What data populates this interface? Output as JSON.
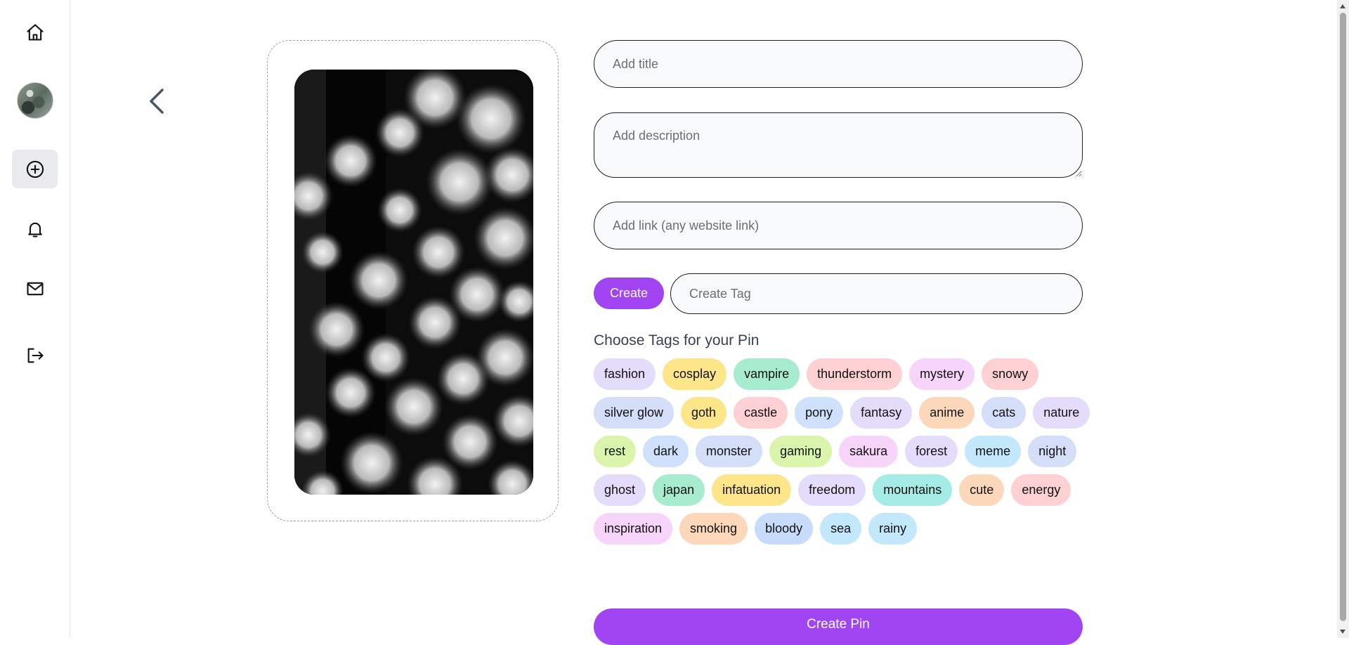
{
  "sidebar": {
    "items": [
      {
        "icon": "home-icon"
      },
      {
        "icon": "avatar"
      },
      {
        "icon": "plus-circle-icon",
        "active": true
      },
      {
        "icon": "bell-icon"
      },
      {
        "icon": "mail-icon"
      },
      {
        "icon": "logout-icon"
      }
    ]
  },
  "form": {
    "title_placeholder": "Add title",
    "description_placeholder": "Add description",
    "link_placeholder": "Add link (any website link)",
    "create_label": "Create",
    "tag_placeholder": "Create Tag",
    "tags_heading": "Choose Tags for your Pin",
    "submit_label": "Create Pin"
  },
  "tags": [
    {
      "label": "fashion",
      "color": "#e4dcfb"
    },
    {
      "label": "cosplay",
      "color": "#fde58a"
    },
    {
      "label": "vampire",
      "color": "#a8ecd0"
    },
    {
      "label": "thunderstorm",
      "color": "#fdd1d4"
    },
    {
      "label": "mystery",
      "color": "#f7d4f9"
    },
    {
      "label": "snowy",
      "color": "#fdd1d4"
    },
    {
      "label": "silver glow",
      "color": "#d5def9"
    },
    {
      "label": "goth",
      "color": "#fde58a"
    },
    {
      "label": "castle",
      "color": "#fdd1d4"
    },
    {
      "label": "pony",
      "color": "#cfe0fc"
    },
    {
      "label": "fantasy",
      "color": "#e4dcfb"
    },
    {
      "label": "anime",
      "color": "#fcd7ba"
    },
    {
      "label": "cats",
      "color": "#d5def9"
    },
    {
      "label": "nature",
      "color": "#e4dcfb"
    },
    {
      "label": "rest",
      "color": "#daf5ab"
    },
    {
      "label": "dark",
      "color": "#cfe0fc"
    },
    {
      "label": "monster",
      "color": "#d5def9"
    },
    {
      "label": "gaming",
      "color": "#daf5ab"
    },
    {
      "label": "sakura",
      "color": "#f7d4f9"
    },
    {
      "label": "forest",
      "color": "#e4dcfb"
    },
    {
      "label": "meme",
      "color": "#c3e7fb"
    },
    {
      "label": "night",
      "color": "#d5def9"
    },
    {
      "label": "ghost",
      "color": "#e4dcfb"
    },
    {
      "label": "japan",
      "color": "#a8ecd0"
    },
    {
      "label": "infatuation",
      "color": "#fde58a"
    },
    {
      "label": "freedom",
      "color": "#e4dcfb"
    },
    {
      "label": "mountains",
      "color": "#a5ece6"
    },
    {
      "label": "cute",
      "color": "#fcd7ba"
    },
    {
      "label": "energy",
      "color": "#fdd1d4"
    },
    {
      "label": "inspiration",
      "color": "#f7d4f9"
    },
    {
      "label": "smoking",
      "color": "#fcd7ba"
    },
    {
      "label": "bloody",
      "color": "#c7dcfb"
    },
    {
      "label": "sea",
      "color": "#c3e7fb"
    },
    {
      "label": "rainy",
      "color": "#c3e7fb"
    }
  ]
}
